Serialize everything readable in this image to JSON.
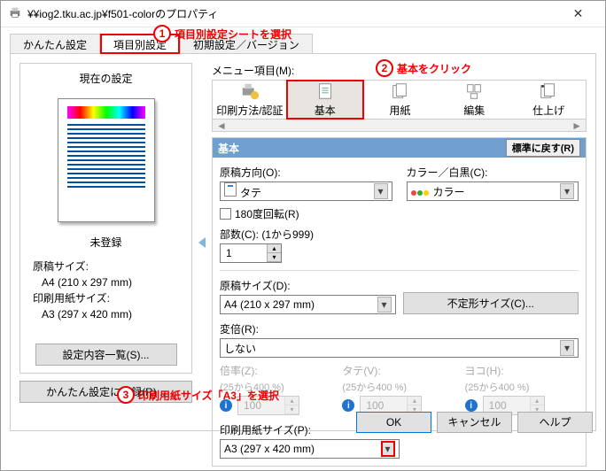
{
  "window": {
    "title": "¥¥iog2.tku.ac.jp¥f501-colorのプロパティ"
  },
  "tabs": {
    "simple": "かんたん設定",
    "detailed": "項目別設定",
    "init": "初期設定／バージョン"
  },
  "annotations": {
    "n1_text": "項目別設定シートを選択",
    "n2_text": "基本をクリック",
    "n3_text": "印刷用紙サイズ「A3」を選択"
  },
  "left": {
    "title": "現在の設定",
    "unregistered": "未登録",
    "doc_size_label": "原稿サイズ:",
    "doc_size_value": "A4 (210 x 297 mm)",
    "print_size_label": "印刷用紙サイズ:",
    "print_size_value": "A3 (297 x 420 mm)",
    "list_btn": "設定内容一覧(S)...",
    "save_btn_outer": "かんたん設定に登録(R)..."
  },
  "menu": {
    "label": "メニュー項目(M):",
    "items": {
      "print_auth": "印刷方法/認証",
      "basic": "基本",
      "paper": "用紙",
      "edit": "編集",
      "finish": "仕上げ"
    }
  },
  "group": {
    "title": "基本",
    "reset": "標準に戻す(R)",
    "orientation_label": "原稿方向(O):",
    "orientation_value": "タテ",
    "color_label": "カラー／白黒(C):",
    "color_value": "カラー",
    "rotate180": "180度回転(R)",
    "copies_label": "部数(C): (1から999)",
    "copies_value": "1",
    "doc_size_label": "原稿サイズ(D):",
    "doc_size_value": "A4 (210 x 297 mm)",
    "irregular_btn": "不定形サイズ(C)...",
    "scale_label": "変倍(R):",
    "scale_value": "しない",
    "ratio_label": "倍率(Z):",
    "ratio_hint": "(25から400 %)",
    "ratio_value": "100",
    "tate_label": "タテ(V):",
    "tate_hint": "(25から400 %)",
    "tate_value": "100",
    "yoko_label": "ヨコ(H):",
    "yoko_hint": "(25から400 %)",
    "yoko_value": "100",
    "papersize_label": "印刷用紙サイズ(P):",
    "papersize_value": "A3 (297 x 420 mm)"
  },
  "footer": {
    "ok": "OK",
    "cancel": "キャンセル",
    "help": "ヘルプ"
  }
}
